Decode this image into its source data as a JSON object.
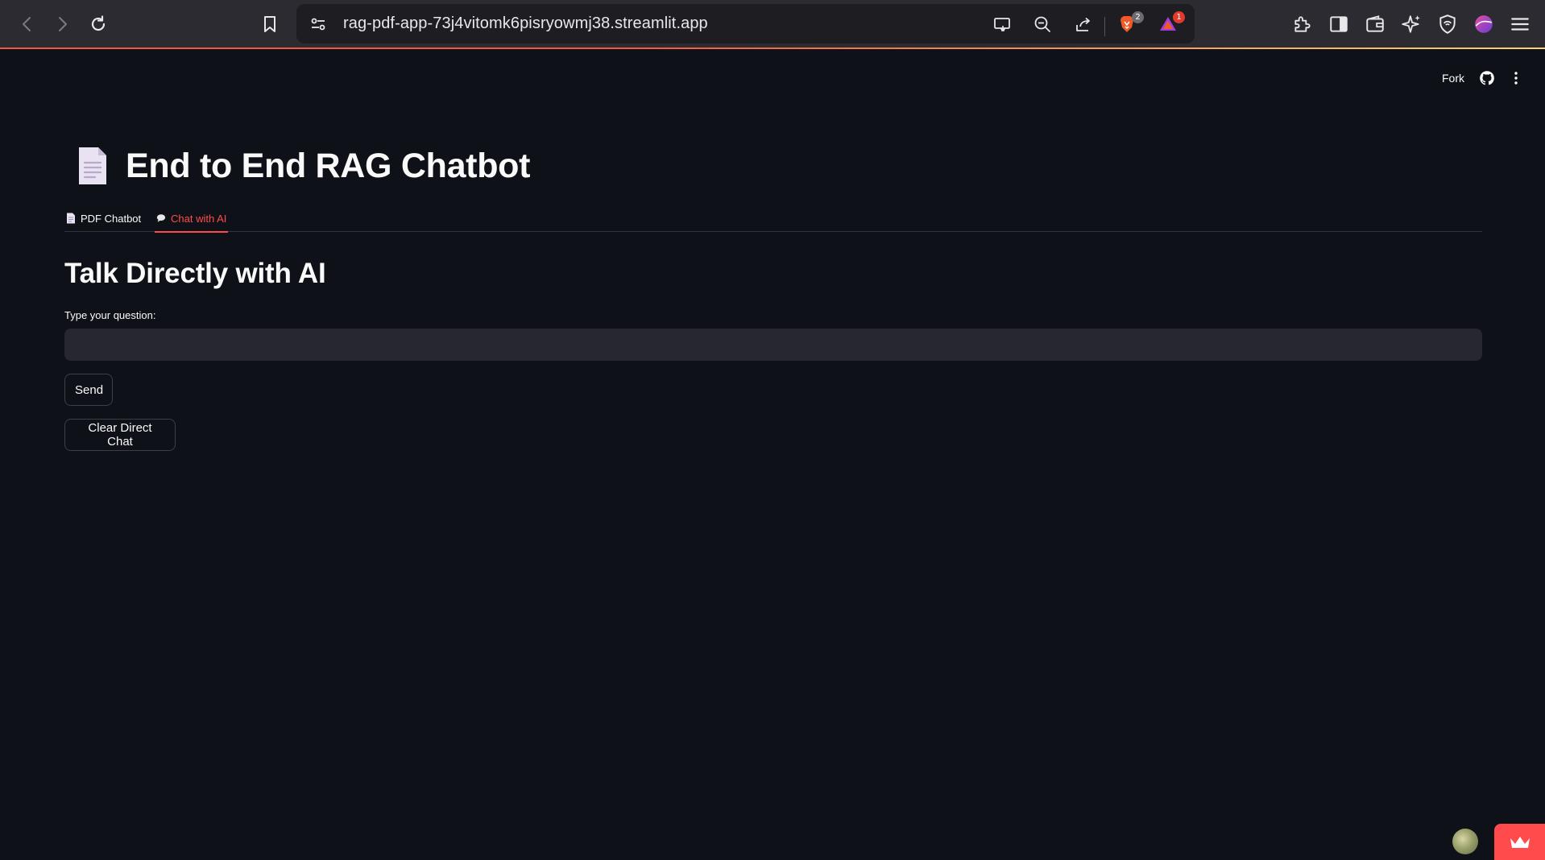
{
  "browser": {
    "url": "rag-pdf-app-73j4vitomk6pisryowmj38.streamlit.app",
    "brave_shield_count": "2",
    "rewards_count": "1"
  },
  "header": {
    "fork_label": "Fork"
  },
  "main": {
    "title": "End to End RAG Chatbot",
    "tabs": [
      {
        "label": "PDF Chatbot",
        "icon": "document-icon",
        "active": false
      },
      {
        "label": "Chat with AI",
        "icon": "speech-bubble-icon",
        "active": true
      }
    ],
    "section_title": "Talk Directly with AI",
    "question_label": "Type your question:",
    "question_value": "",
    "send_label": "Send",
    "clear_label": "Clear Direct Chat"
  },
  "colors": {
    "background": "#0e1117",
    "accent": "#ff4b4b",
    "input_bg": "#262730",
    "browser_bar": "#2b2b31"
  }
}
